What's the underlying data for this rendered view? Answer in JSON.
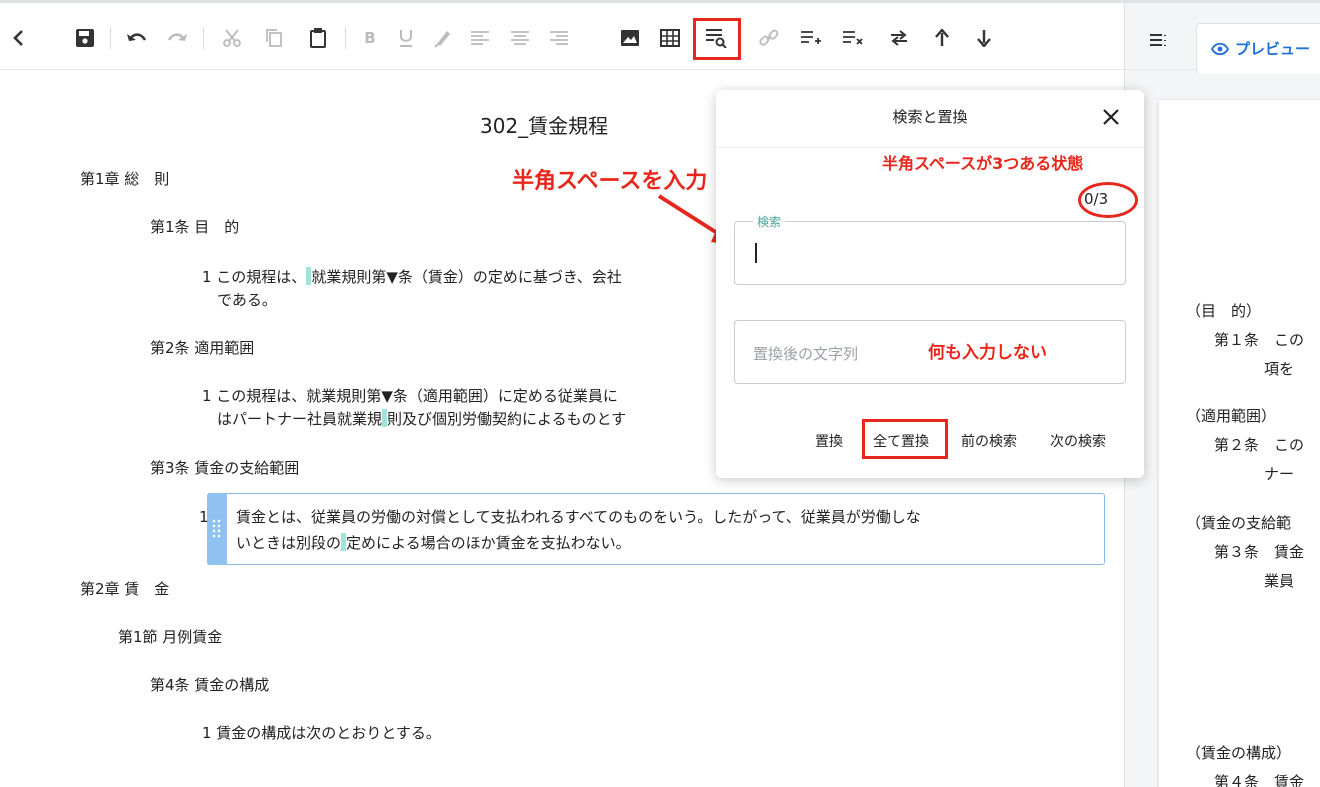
{
  "toolbar": {
    "format_letters": {
      "bold": "B",
      "underline": "U"
    }
  },
  "right_panel": {
    "preview_tab_label": "プレビュー",
    "preview_lines": [
      "（目　的）",
      "第１条　この",
      "項を",
      "（適用範囲）",
      "第２条　この",
      "ナー",
      "（賃金の支給範",
      "第３条　賃金",
      "業員",
      "（賃金の構成）",
      "第４条　賃金"
    ]
  },
  "document": {
    "title": "302_賃金規程",
    "lines": [
      "第1章 総　則",
      "第1条 目　的",
      "1 この規程は、",
      "就業規則第▼条（賃金）の定めに基づき、会社",
      "である。",
      "第2条 適用範囲",
      "1 この規程は、就業規則第▼条（適用範囲）に定める従業員に",
      "はパートナー社員就業規",
      "則及び個別労働契約によるものとす",
      "第3条 賃金の支給範囲",
      "1",
      "賃金とは、従業員の労働の対償として支払われるすべてのものをいう。したがって、従業員が労働しな",
      "いときは別段の",
      "定めによる場合のほか賃金を支払わない。",
      "第2章 賃　金",
      "第1節 月例賃金",
      "第4条 賃金の構成",
      "1 賃金の構成は次のとおりとする。"
    ]
  },
  "dialog": {
    "title": "検索と置換",
    "count": "0/3",
    "search_label": "検索",
    "search_value": "",
    "replace_placeholder": "置換後の文字列",
    "buttons": {
      "replace": "置換",
      "replace_all": "全て置換",
      "prev": "前の検索",
      "next": "次の検索"
    }
  },
  "annotations": {
    "enter_space": "半角スペースを入力",
    "three_spaces": "半角スペースが3つある状態",
    "no_input": "何も入力しない"
  },
  "colors": {
    "annotation_red": "#e8271c",
    "accent_blue": "#1e6fd9",
    "legend_teal": "#4aa59a",
    "highlight_teal": "#9fe3dc"
  }
}
